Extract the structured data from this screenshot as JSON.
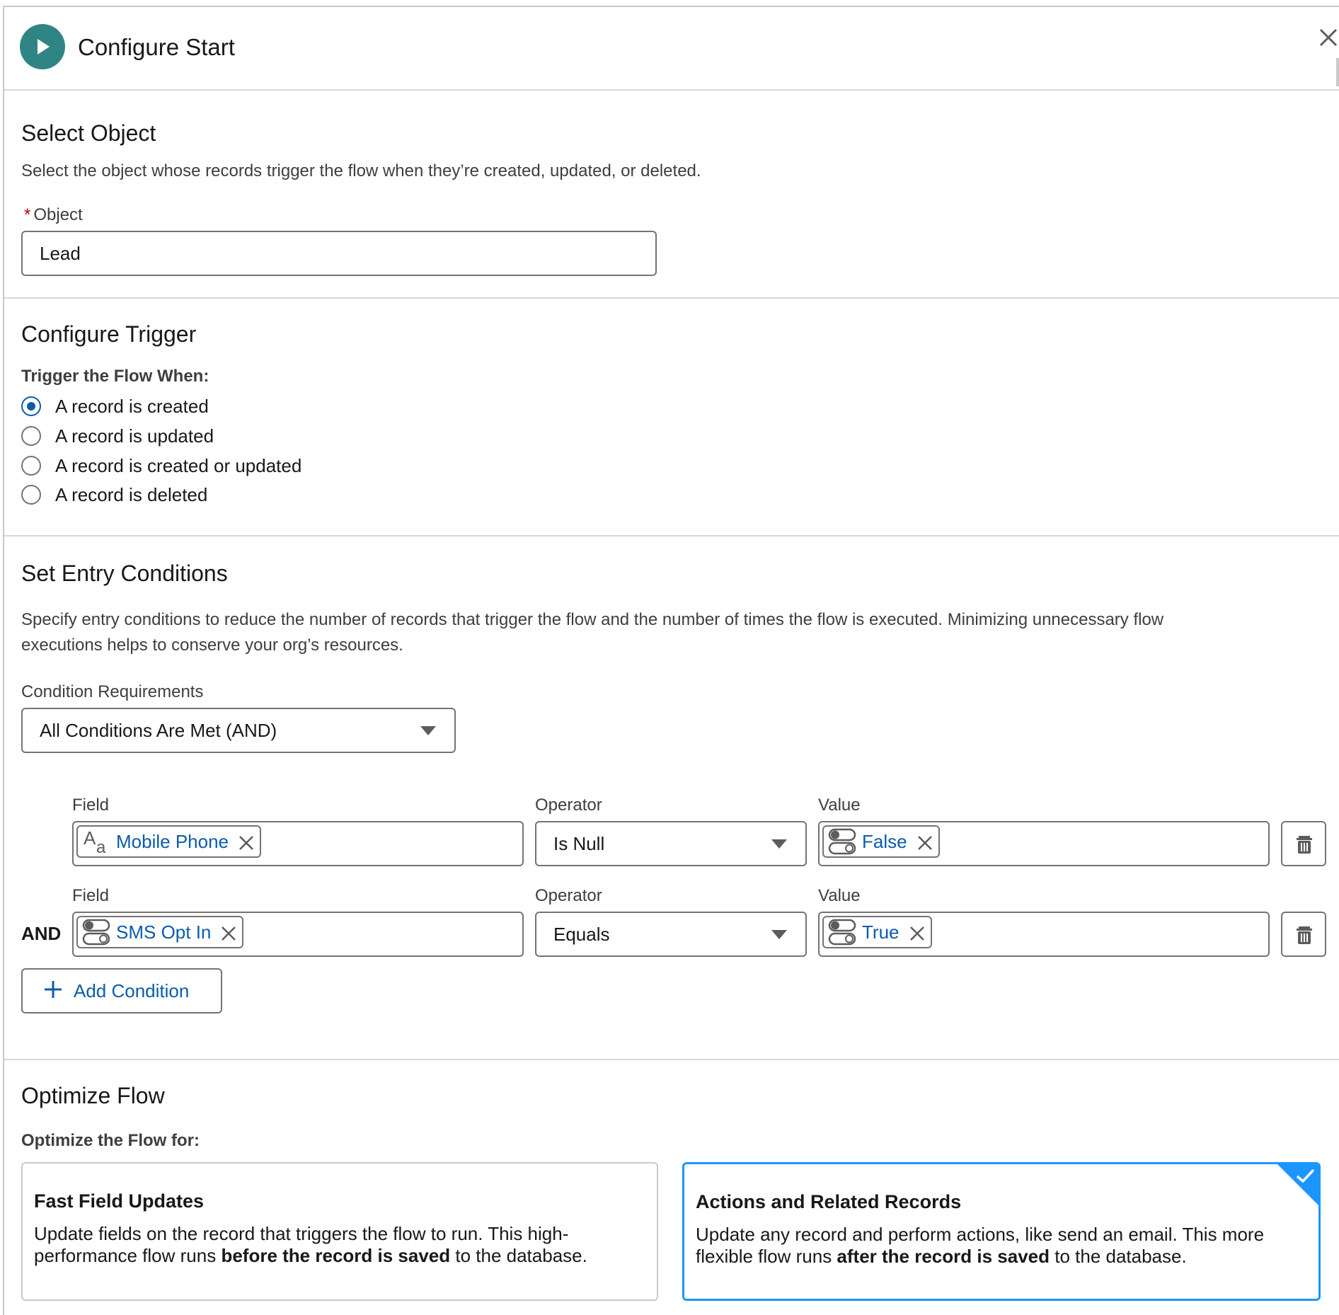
{
  "header": {
    "title": "Configure Start",
    "start_icon": "play-icon",
    "close_icon": "close-icon"
  },
  "select_object": {
    "title": "Select Object",
    "description": "Select the object whose records trigger the flow when they’re created, updated, or deleted.",
    "required_marker": "*",
    "object_label": "Object",
    "object_value": "Lead"
  },
  "configure_trigger": {
    "title": "Configure Trigger",
    "trigger_label": "Trigger the Flow When:",
    "options": [
      {
        "label": "A record is created",
        "selected": true
      },
      {
        "label": "A record is updated",
        "selected": false
      },
      {
        "label": "A record is created or updated",
        "selected": false
      },
      {
        "label": "A record is deleted",
        "selected": false
      }
    ]
  },
  "entry_conditions": {
    "title": "Set Entry Conditions",
    "description_line1": "Specify entry conditions to reduce the number of records that trigger the flow and the number of times the flow is executed. Minimizing unnecessary flow",
    "description_line2": "executions helps to conserve your org’s resources.",
    "requirements_label": "Condition Requirements",
    "requirements_value": "All Conditions Are Met (AND)",
    "conditions": [
      {
        "logic": "",
        "field_label": "Field",
        "field_value": "Mobile Phone",
        "field_icon": "text-field-icon",
        "operator_label": "Operator",
        "operator_value": "Is Null",
        "value_label": "Value",
        "value_value": "False",
        "value_icon": "toggle-icon"
      },
      {
        "logic": "AND",
        "field_label": "Field",
        "field_value": "SMS Opt In",
        "field_icon": "toggle-icon",
        "operator_label": "Operator",
        "operator_value": "Equals",
        "value_label": "Value",
        "value_value": "True",
        "value_icon": "toggle-icon"
      }
    ],
    "add_condition_label": "Add Condition"
  },
  "optimize": {
    "title": "Optimize Flow",
    "label": "Optimize the Flow for:",
    "cards": [
      {
        "title": "Fast Field Updates",
        "desc_a": "Update fields on the record that triggers the flow to run. This high-performance flow runs ",
        "desc_bold": "before the record is saved",
        "desc_b": " to the database.",
        "selected": false
      },
      {
        "title": "Actions and Related Records",
        "desc_a": "Update any record and perform actions, like send an email. This more flexible flow runs ",
        "desc_bold": "after the record is saved",
        "desc_b": " to the database.",
        "selected": true
      }
    ]
  },
  "colors": {
    "brand_teal": "#2f8584",
    "link_blue": "#0b5cab",
    "selected_border": "#1b96ff",
    "required_red": "#ba0517"
  }
}
